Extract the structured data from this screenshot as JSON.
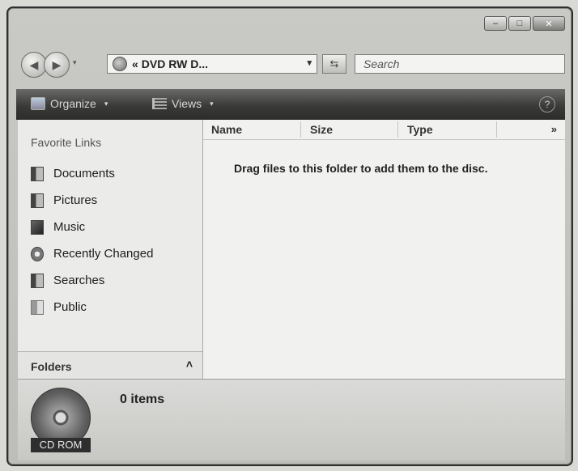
{
  "window": {
    "caption_buttons": {
      "minimize": "–",
      "maximize": "□",
      "close": "✕"
    }
  },
  "address_bar": {
    "chevrons": "«",
    "path": "DVD RW D...",
    "dropdown_glyph": "▾",
    "refresh_glyph": "⇆",
    "search_placeholder": "Search"
  },
  "toolbar": {
    "organize_label": "Organize",
    "views_label": "Views",
    "caret": "▾",
    "help_glyph": "?"
  },
  "nav_pane": {
    "title": "Favorite Links",
    "links": [
      {
        "label": "Documents",
        "icon": "documents-icon"
      },
      {
        "label": "Pictures",
        "icon": "pictures-icon"
      },
      {
        "label": "Music",
        "icon": "music-icon"
      },
      {
        "label": "Recently Changed",
        "icon": "recently-changed-icon"
      },
      {
        "label": "Searches",
        "icon": "searches-icon"
      },
      {
        "label": "Public",
        "icon": "public-icon"
      }
    ],
    "folders_label": "Folders",
    "folders_caret": "˄"
  },
  "content": {
    "columns": [
      "Name",
      "Size",
      "Type"
    ],
    "more_columns": "»",
    "empty_message": "Drag files to this folder to add them to the disc."
  },
  "details": {
    "drive_label": "CD ROM",
    "item_count": "0 items"
  }
}
